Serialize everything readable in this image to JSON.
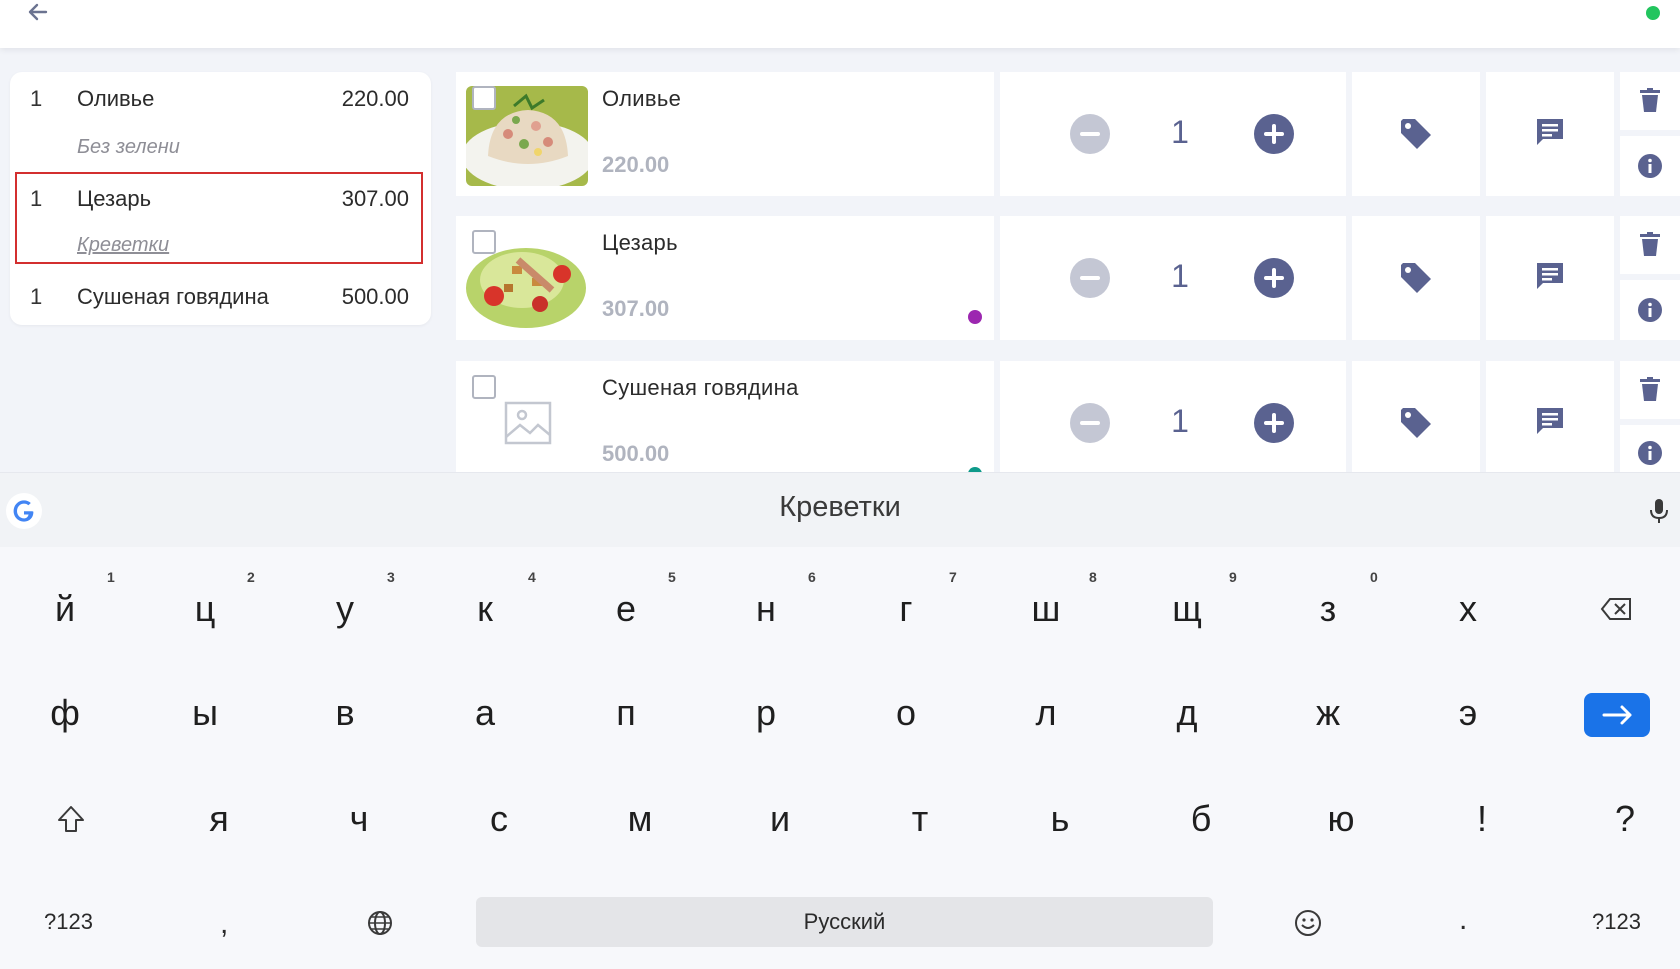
{
  "topbar": {
    "back_icon": "arrow-left-icon",
    "status_color": "#22c55e"
  },
  "order": [
    {
      "qty": "1",
      "name": "Оливье",
      "price": "220.00",
      "modifier": "Без зелени"
    },
    {
      "qty": "1",
      "name": "Цезарь",
      "price": "307.00",
      "modifier": "Креветки"
    },
    {
      "qty": "1",
      "name": "Сушеная говядина",
      "price": "500.00"
    }
  ],
  "items": [
    {
      "name": "Оливье",
      "price": "220.00",
      "qty": "1",
      "image": "olivier-photo"
    },
    {
      "name": "Цезарь",
      "price": "307.00",
      "qty": "1",
      "image": "caesar-photo",
      "dot_color": "#9c27b0"
    },
    {
      "name": "Сушеная говядина",
      "price": "500.00",
      "qty": "1",
      "image": "image-placeholder-icon",
      "dot_color": "#0e9a8a"
    }
  ],
  "keyboard": {
    "suggestion": "Креветки",
    "row1": [
      "й",
      "ц",
      "у",
      "к",
      "е",
      "н",
      "г",
      "ш",
      "щ",
      "з",
      "х"
    ],
    "row1_hints": [
      "1",
      "2",
      "3",
      "4",
      "5",
      "6",
      "7",
      "8",
      "9",
      "0"
    ],
    "row2": [
      "ф",
      "ы",
      "в",
      "а",
      "п",
      "р",
      "о",
      "л",
      "д",
      "ж",
      "э"
    ],
    "row3": [
      "я",
      "ч",
      "с",
      "м",
      "и",
      "т",
      "ь",
      "б",
      "ю",
      "!",
      "?"
    ],
    "symbols_left": "?123",
    "comma": ",",
    "space_label": "Русский",
    "period": ".",
    "symbols_right": "?123",
    "enter_color": "#1a73e8"
  }
}
